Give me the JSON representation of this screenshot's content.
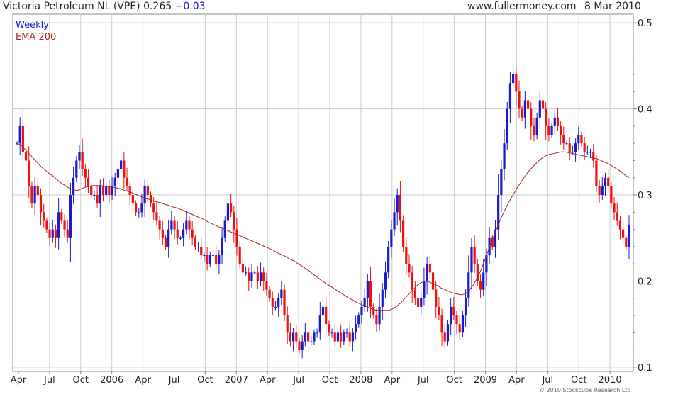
{
  "header": {
    "title": "Victoria Petroleum NL (VPE) 0.265",
    "change": "+0.03",
    "site": "www.fullermoney.com",
    "date": "8 Mar 2010"
  },
  "copyright": "© 2010 Stockcube Research Ltd",
  "colors": {
    "up": "#1a1acc",
    "down": "#ee1111",
    "ema": "#aa2222",
    "grid": "#cccccc",
    "frame": "#888888"
  },
  "chart_data": {
    "type": "bar",
    "title": "Victoria Petroleum NL (VPE) 0.265 +0.03",
    "legend": [
      "Weekly",
      "EMA 200"
    ],
    "legend_position": "top-left",
    "grid": true,
    "x_labels": [
      "Apr",
      "Jul",
      "Oct",
      "2006",
      "Apr",
      "Jul",
      "Oct",
      "2007",
      "Apr",
      "Jul",
      "Oct",
      "2008",
      "Apr",
      "Jul",
      "Oct",
      "2009",
      "Apr",
      "Jul",
      "Oct",
      "2010"
    ],
    "x_range": [
      "2005-03-28",
      "2010-03-08"
    ],
    "ylim": [
      0.095,
      0.51
    ],
    "yticks": [
      0.1,
      0.2,
      0.3,
      0.4,
      0.5
    ],
    "ytick_labels": [
      "0.1",
      "0.2",
      "0.3",
      "0.4",
      "0.5"
    ],
    "y_axis_side": "right",
    "weekly_close": [
      0.36,
      0.38,
      0.35,
      0.34,
      0.31,
      0.29,
      0.31,
      0.3,
      0.28,
      0.27,
      0.26,
      0.25,
      0.26,
      0.25,
      0.28,
      0.27,
      0.26,
      0.25,
      0.3,
      0.32,
      0.34,
      0.35,
      0.33,
      0.32,
      0.31,
      0.3,
      0.3,
      0.29,
      0.31,
      0.3,
      0.31,
      0.3,
      0.31,
      0.32,
      0.33,
      0.34,
      0.32,
      0.31,
      0.3,
      0.29,
      0.28,
      0.28,
      0.29,
      0.31,
      0.3,
      0.29,
      0.28,
      0.27,
      0.26,
      0.25,
      0.24,
      0.26,
      0.27,
      0.26,
      0.25,
      0.25,
      0.26,
      0.27,
      0.26,
      0.25,
      0.24,
      0.24,
      0.23,
      0.23,
      0.22,
      0.23,
      0.23,
      0.22,
      0.23,
      0.25,
      0.27,
      0.29,
      0.28,
      0.26,
      0.24,
      0.22,
      0.21,
      0.21,
      0.2,
      0.21,
      0.21,
      0.2,
      0.21,
      0.2,
      0.19,
      0.18,
      0.17,
      0.17,
      0.18,
      0.19,
      0.16,
      0.14,
      0.13,
      0.14,
      0.13,
      0.12,
      0.13,
      0.14,
      0.13,
      0.13,
      0.14,
      0.14,
      0.16,
      0.17,
      0.15,
      0.14,
      0.14,
      0.13,
      0.14,
      0.13,
      0.14,
      0.14,
      0.13,
      0.14,
      0.15,
      0.16,
      0.17,
      0.18,
      0.2,
      0.17,
      0.16,
      0.15,
      0.17,
      0.19,
      0.21,
      0.24,
      0.26,
      0.28,
      0.3,
      0.27,
      0.24,
      0.22,
      0.21,
      0.19,
      0.18,
      0.17,
      0.18,
      0.2,
      0.22,
      0.21,
      0.19,
      0.17,
      0.16,
      0.14,
      0.13,
      0.15,
      0.17,
      0.16,
      0.15,
      0.14,
      0.16,
      0.18,
      0.21,
      0.24,
      0.22,
      0.2,
      0.19,
      0.21,
      0.23,
      0.25,
      0.24,
      0.26,
      0.3,
      0.33,
      0.36,
      0.4,
      0.43,
      0.44,
      0.42,
      0.4,
      0.39,
      0.41,
      0.4,
      0.38,
      0.37,
      0.39,
      0.41,
      0.4,
      0.38,
      0.37,
      0.38,
      0.39,
      0.38,
      0.37,
      0.36,
      0.36,
      0.35,
      0.35,
      0.36,
      0.37,
      0.36,
      0.35,
      0.35,
      0.35,
      0.34,
      0.31,
      0.3,
      0.31,
      0.32,
      0.31,
      0.29,
      0.28,
      0.27,
      0.26,
      0.25,
      0.24,
      0.265
    ],
    "ema_200": [
      0.36,
      0.358,
      0.353,
      0.348,
      0.343,
      0.338,
      0.333,
      0.329,
      0.325,
      0.322,
      0.318,
      0.314,
      0.311,
      0.308,
      0.306,
      0.305,
      0.307,
      0.309,
      0.31,
      0.311,
      0.311,
      0.311,
      0.31,
      0.31,
      0.309,
      0.308,
      0.307,
      0.305,
      0.304,
      0.302,
      0.3,
      0.298,
      0.296,
      0.295,
      0.293,
      0.292,
      0.291,
      0.289,
      0.288,
      0.286,
      0.285,
      0.283,
      0.281,
      0.279,
      0.277,
      0.275,
      0.273,
      0.271,
      0.268,
      0.266,
      0.264,
      0.262,
      0.26,
      0.258,
      0.256,
      0.254,
      0.252,
      0.25,
      0.248,
      0.246,
      0.244,
      0.242,
      0.24,
      0.238,
      0.236,
      0.233,
      0.231,
      0.229,
      0.226,
      0.224,
      0.221,
      0.218,
      0.215,
      0.212,
      0.208,
      0.205,
      0.201,
      0.198,
      0.195,
      0.192,
      0.189,
      0.186,
      0.183,
      0.18,
      0.178,
      0.175,
      0.173,
      0.171,
      0.169,
      0.167,
      0.166,
      0.166,
      0.166,
      0.166,
      0.168,
      0.171,
      0.175,
      0.18,
      0.185,
      0.19,
      0.195,
      0.198,
      0.2,
      0.199,
      0.197,
      0.195,
      0.192,
      0.19,
      0.188,
      0.186,
      0.185,
      0.184,
      0.185,
      0.189,
      0.195,
      0.203,
      0.213,
      0.225,
      0.238,
      0.25,
      0.262,
      0.273,
      0.283,
      0.292,
      0.3,
      0.308,
      0.315,
      0.322,
      0.328,
      0.333,
      0.338,
      0.342,
      0.345,
      0.347,
      0.348,
      0.349,
      0.35,
      0.35,
      0.349,
      0.348,
      0.347,
      0.346,
      0.345,
      0.344,
      0.343,
      0.342,
      0.34,
      0.338,
      0.336,
      0.333,
      0.33,
      0.327,
      0.323,
      0.32
    ]
  }
}
